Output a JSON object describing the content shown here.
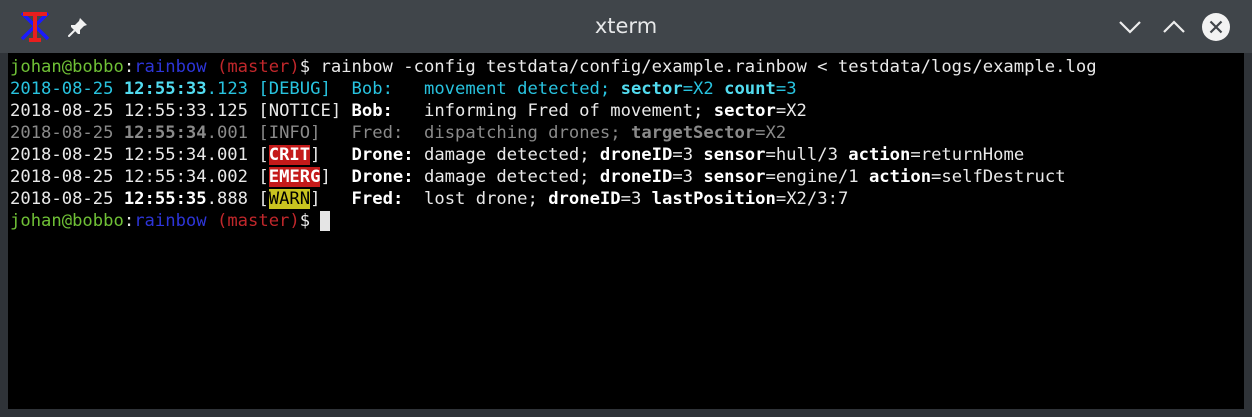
{
  "window": {
    "title": "xterm",
    "app_icon": "xterm-icon",
    "pin_icon": "pin-icon",
    "minimize_icon": "chevron-down-icon",
    "maximize_icon": "chevron-up-icon",
    "close_icon": "close-icon"
  },
  "colors": {
    "prompt_user": "#6fc036",
    "prompt_dir": "#2d35d8",
    "prompt_branch": "#c0272b",
    "debug": "#28c3df",
    "info_dim": "#8a8a8a",
    "crit_bg": "#c41a1a",
    "warn_bg": "#c9c420"
  },
  "terminal": {
    "prompt_user": "johan@bobbo",
    "prompt_sep": ":",
    "prompt_dir": "rainbow",
    "prompt_branch": " (master)",
    "prompt_symbol": "$ ",
    "command": "rainbow -config testdata/config/example.rainbow < testdata/logs/example.log",
    "logs": [
      {
        "date": "2018-08-25 ",
        "time_bold": "12:55:33",
        "time_ms": ".123",
        "level": "DEBUG",
        "source": "Bob:",
        "pad": "   ",
        "message": "movement detected; ",
        "k1": "sector",
        "v1": "=X2 ",
        "k2": "count",
        "v2": "=3"
      },
      {
        "date": "2018-08-25 ",
        "time": "12:55:33.125",
        "level": "NOTICE",
        "source": "Bob:",
        "pad": "   ",
        "message": "informing Fred of movement; ",
        "k1": "sector",
        "v1": "=X2"
      },
      {
        "date": "2018-08-25 ",
        "time_bold": "12:55:34",
        "time_ms": ".001",
        "level": "INFO",
        "source": "Fred:",
        "pad": "  ",
        "message": "dispatching drones; ",
        "k1": "targetSector",
        "v1": "=X2"
      },
      {
        "date": "2018-08-25 ",
        "time": "12:55:34.001",
        "level": "CRIT",
        "source": "Drone:",
        "pad": " ",
        "message": "damage detected; ",
        "k1": "droneID",
        "v1": "=3 ",
        "k2": "sensor",
        "v2": "=hull/3 ",
        "k3": "action",
        "v3": "=returnHome"
      },
      {
        "date": "2018-08-25 ",
        "time": "12:55:34.002",
        "level": "EMERG",
        "source": "Drone:",
        "pad": " ",
        "message": "damage detected; ",
        "k1": "droneID",
        "v1": "=3 ",
        "k2": "sensor",
        "v2": "=engine/1 ",
        "k3": "action",
        "v3": "=selfDestruct"
      },
      {
        "date": "2018-08-25 ",
        "time_bold": "12:55:35",
        "time_ms": ".888",
        "level": "WARN",
        "source": "Fred:",
        "pad": "  ",
        "message": "lost drone; ",
        "k1": "droneID",
        "v1": "=3 ",
        "k2": "lastPosition",
        "v2": "=X2/3:7"
      }
    ]
  }
}
